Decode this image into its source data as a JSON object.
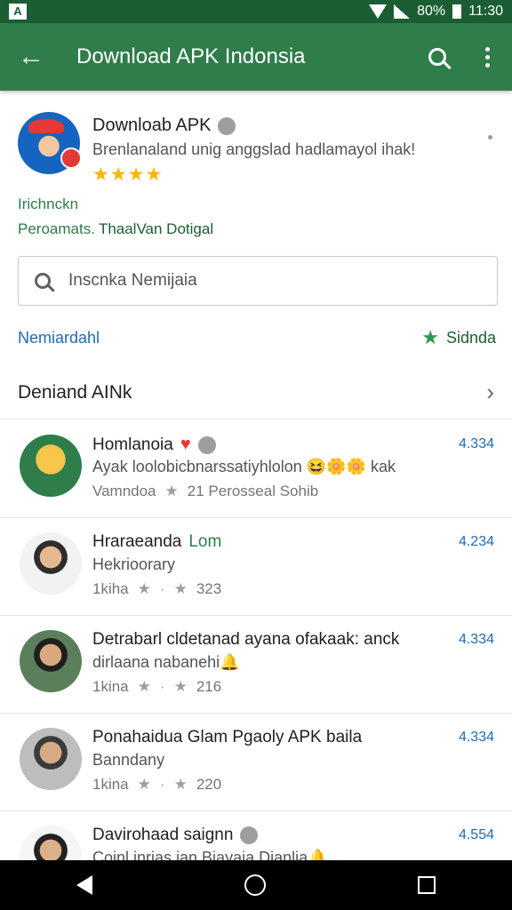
{
  "status_bar": {
    "app_glyph": "A",
    "battery": "80%",
    "time": "11:30"
  },
  "app_bar": {
    "back_icon": "arrow-left",
    "title": "Download APK Indonsia",
    "search_icon": "search",
    "more_icon": "more-vertical"
  },
  "profile": {
    "name": "Downloab APK",
    "description": "Brenlanaland unig anggslad hadlamayol ihak!",
    "stars": "★★★★"
  },
  "section": {
    "label": "Irichnckn",
    "sub_label": "Peroamats.",
    "sub_value": "ThaalVan Dotigal"
  },
  "search": {
    "placeholder": "Inscnka Nemijaia"
  },
  "filter": {
    "left": "Nemiardahl",
    "right": "Sidnda"
  },
  "section_header": {
    "title": "Deniand AINk"
  },
  "list": [
    {
      "title": "Homlanoia",
      "line2": "Ayak loolobicbnarssatiyhlolon 😆🌼🌼 kak",
      "meta_left": "Vamndoa",
      "meta_right": "21 Perosseal Sohib",
      "rating": "4.334"
    },
    {
      "title": "Hraraeanda",
      "title_badge": "Lom",
      "line2": "Hekrioorary",
      "meta_left": "1kiha",
      "meta_right": "323",
      "rating": "4.234"
    },
    {
      "title": "Detrabarl cldetanad ayana ofakaak: anck",
      "line2": "dirlaana nabanehi🔔",
      "meta_left": "1kina",
      "meta_right": "216",
      "rating": "4.334"
    },
    {
      "title": "Ponahaidua Glam Pgaoly APK baila",
      "line2": "Banndany",
      "meta_left": "1kina",
      "meta_right": "220",
      "rating": "4.334"
    },
    {
      "title": "Davirohaad saignn",
      "line2": "Coinl inrias ian Biayaia Dianlia🔔",
      "meta_left": "",
      "meta_right": "",
      "rating": "4.554"
    }
  ]
}
